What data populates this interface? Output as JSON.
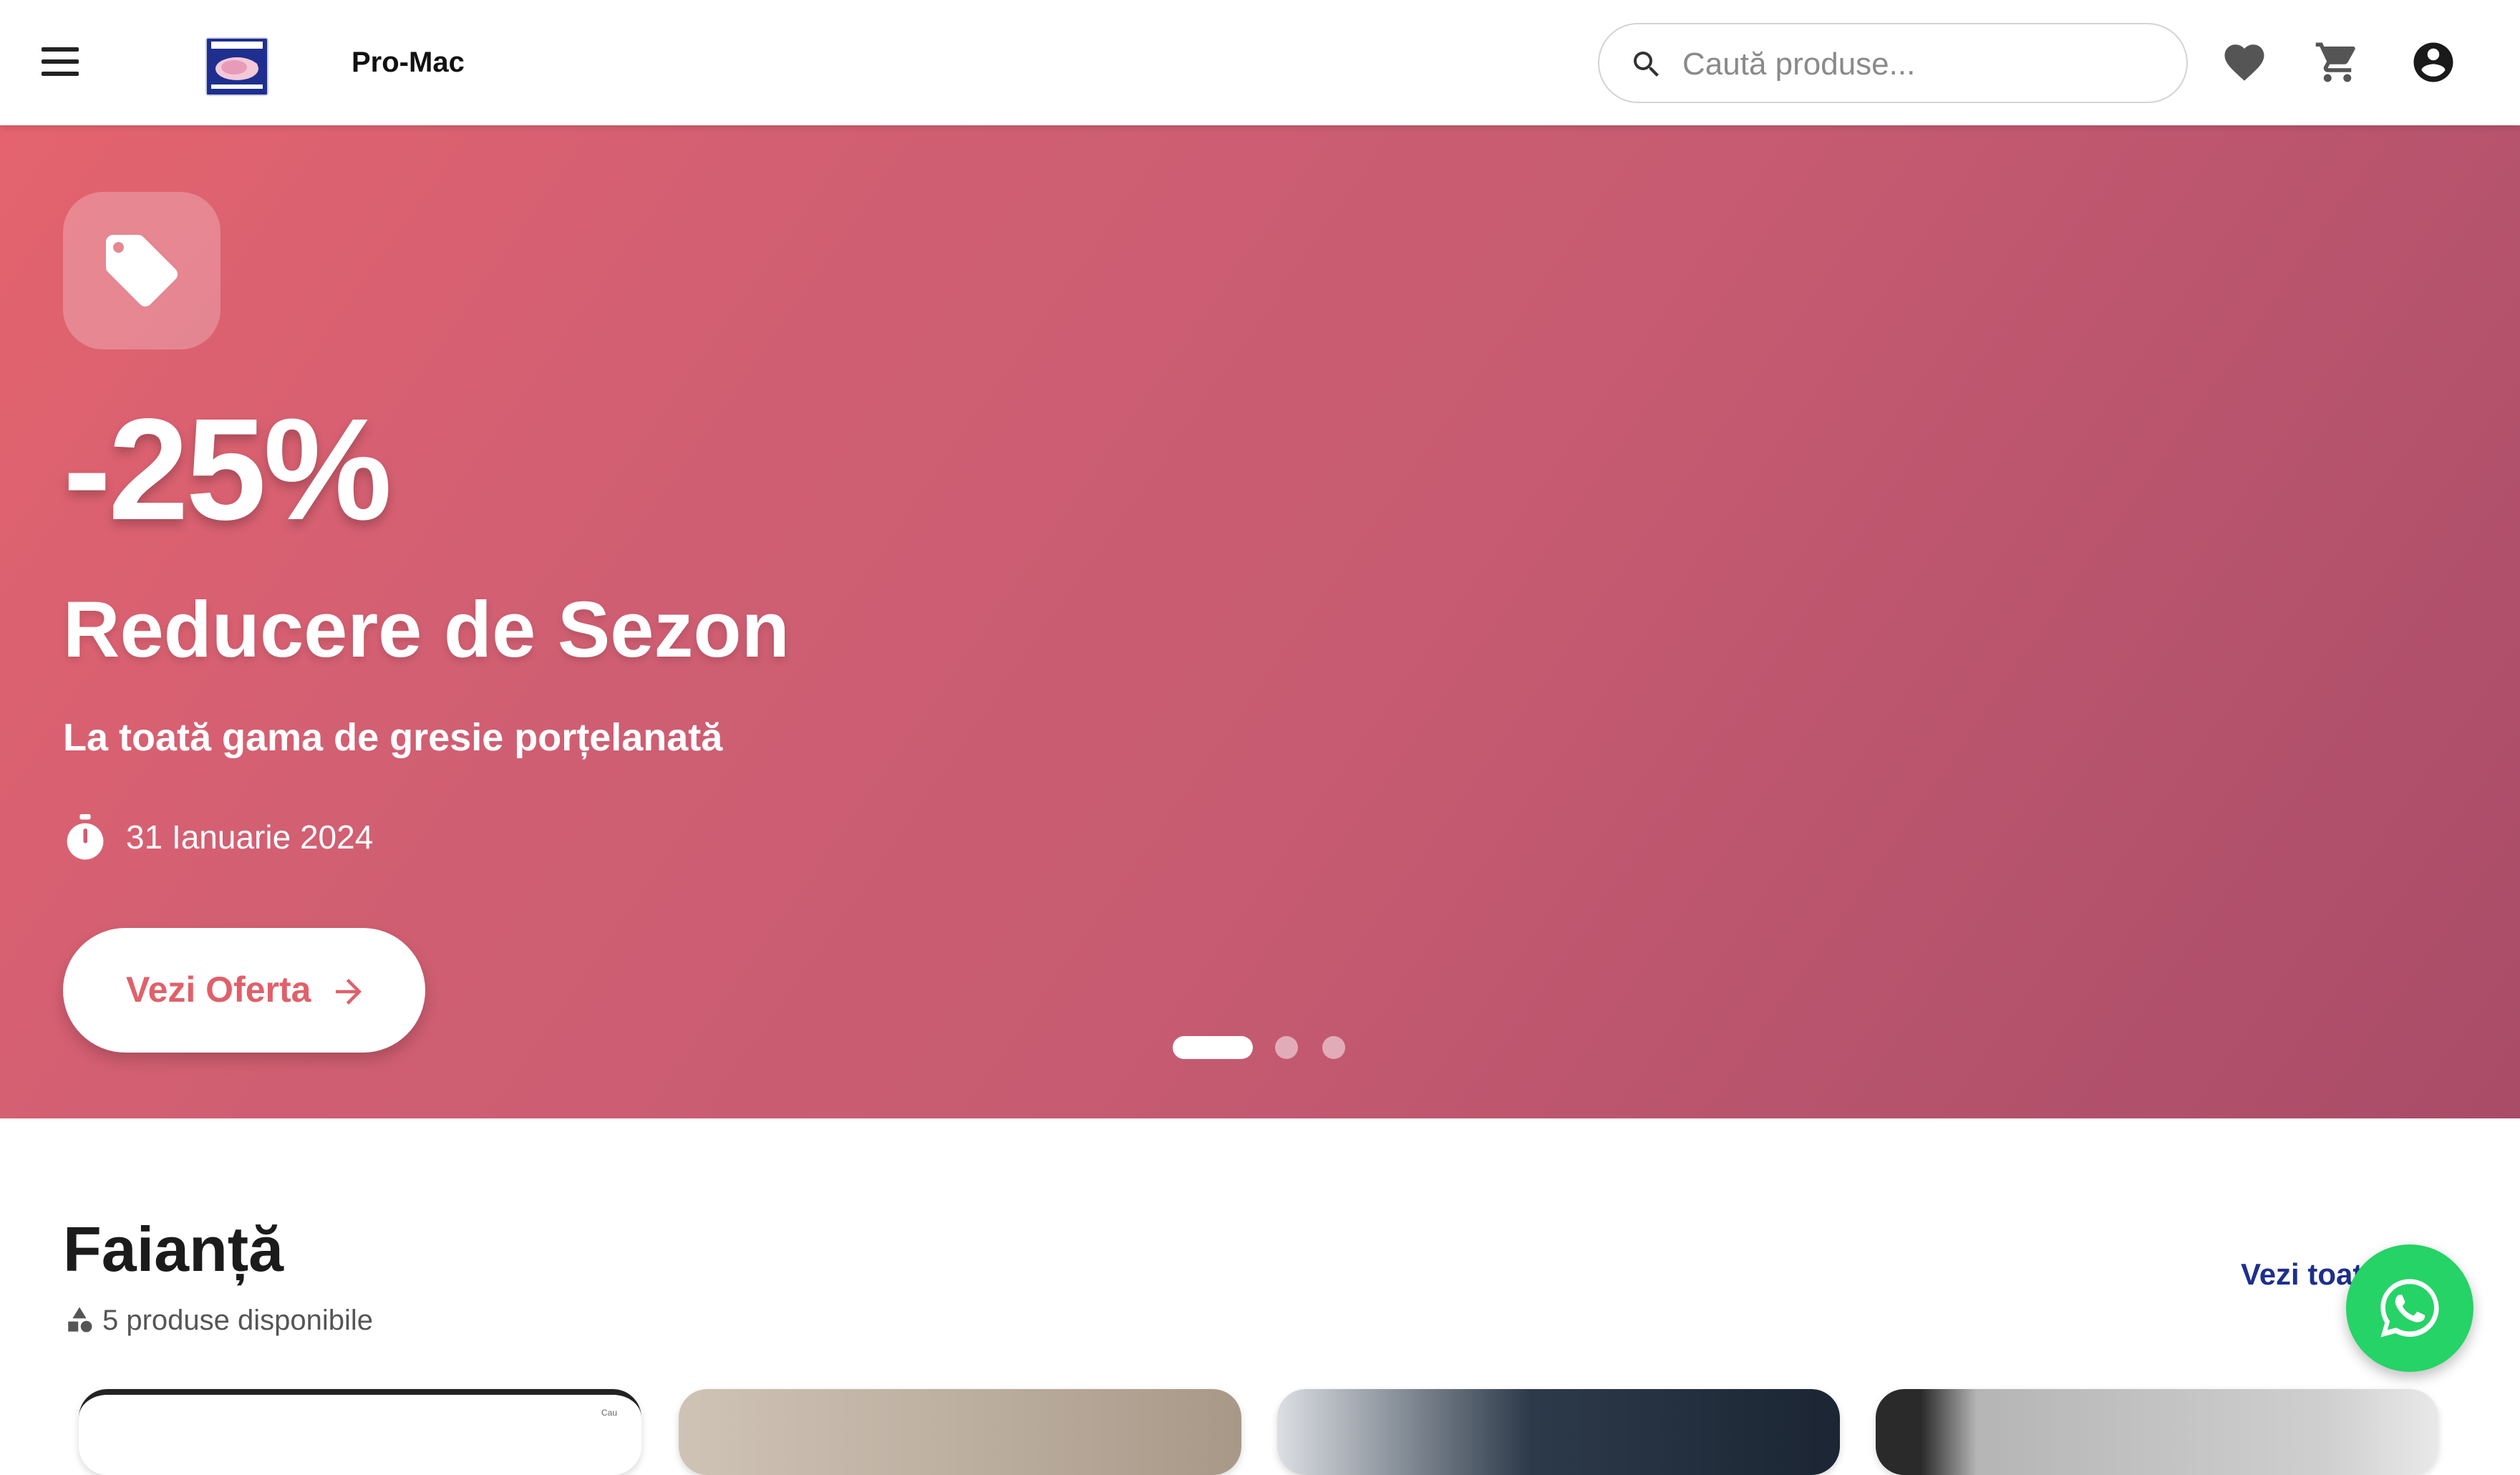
{
  "header": {
    "brand": "Pro-Mac",
    "search_placeholder": "Caută produse...",
    "icons": [
      "menu-icon",
      "search-icon",
      "heart-icon",
      "cart-icon",
      "account-icon"
    ]
  },
  "hero": {
    "discount": "-25%",
    "title": "Reducere de Sezon",
    "subtitle": "La toată gama de gresie porțelanată",
    "date": "31 Ianuarie 2024",
    "cta_label": "Vezi Oferta",
    "slides_total": 3,
    "active_slide": 1,
    "gradient_start": "#e4636e",
    "gradient_end": "#a94c68"
  },
  "category": {
    "title": "Faianță",
    "count_text": "5 produse disponibile",
    "see_all_label": "Vezi toate",
    "card_mini_text": "Cau"
  },
  "colors": {
    "accent_blue": "#1e2f8c",
    "cta_text": "#e0606a",
    "whatsapp": "#25d366"
  }
}
